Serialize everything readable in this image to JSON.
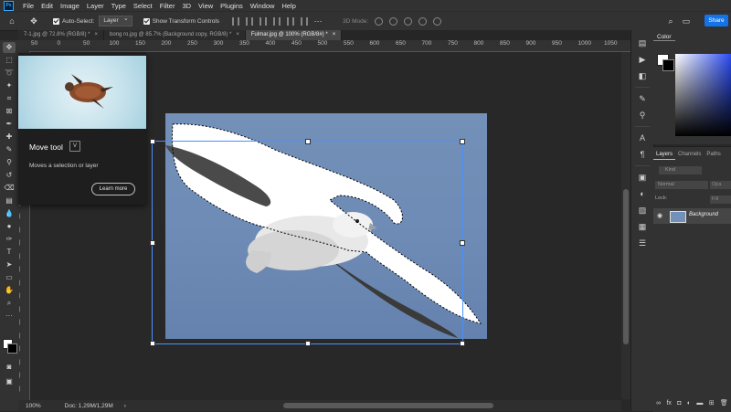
{
  "app": {
    "logo": "Ps"
  },
  "menu": [
    "File",
    "Edit",
    "Image",
    "Layer",
    "Type",
    "Select",
    "Filter",
    "3D",
    "View",
    "Plugins",
    "Window",
    "Help"
  ],
  "options": {
    "auto_select_label": "Auto-Select:",
    "auto_select_value": "Layer",
    "show_transform_label": "Show Transform Controls",
    "mode_3d_label": "3D Mode:",
    "share_label": "Share"
  },
  "tabs": [
    {
      "label": "7-1.jpg @ 72.8% (RGB/8) *",
      "close": "×"
    },
    {
      "label": "bong ro.jpg @ 85.7% (Background copy, RGB/8) *",
      "close": "×"
    },
    {
      "label": "Fulmar.jpg @ 100% (RGB/8#) *",
      "close": "×"
    }
  ],
  "ruler_top_ticks": [
    "50",
    "0",
    "50",
    "100",
    "150",
    "200",
    "250",
    "300",
    "350",
    "400",
    "450",
    "500",
    "550",
    "600",
    "650",
    "700",
    "750",
    "800",
    "850",
    "900",
    "950",
    "1000",
    "1050"
  ],
  "tooltip": {
    "title": "Move tool",
    "shortcut": "V",
    "description": "Moves a selection or layer",
    "learn_more": "Learn more"
  },
  "status": {
    "zoom": "100%",
    "doc": "Doc: 1,29M/1,29M"
  },
  "color_panel": {
    "tab": "Color"
  },
  "layers_panel": {
    "tabs": [
      "Layers",
      "Channels",
      "Paths"
    ],
    "kind_placeholder": "Kind",
    "blend_mode": "Normal",
    "opacity_label": "Opa",
    "lock_label": "Lock:",
    "fill_label": "Fill",
    "layer_name": "Background"
  },
  "colors": {
    "accent": "#1473e6",
    "selection": "#4a90ff",
    "canvas_sky": "#7390b8",
    "foreground": "#ffffff",
    "background": "#000000"
  }
}
